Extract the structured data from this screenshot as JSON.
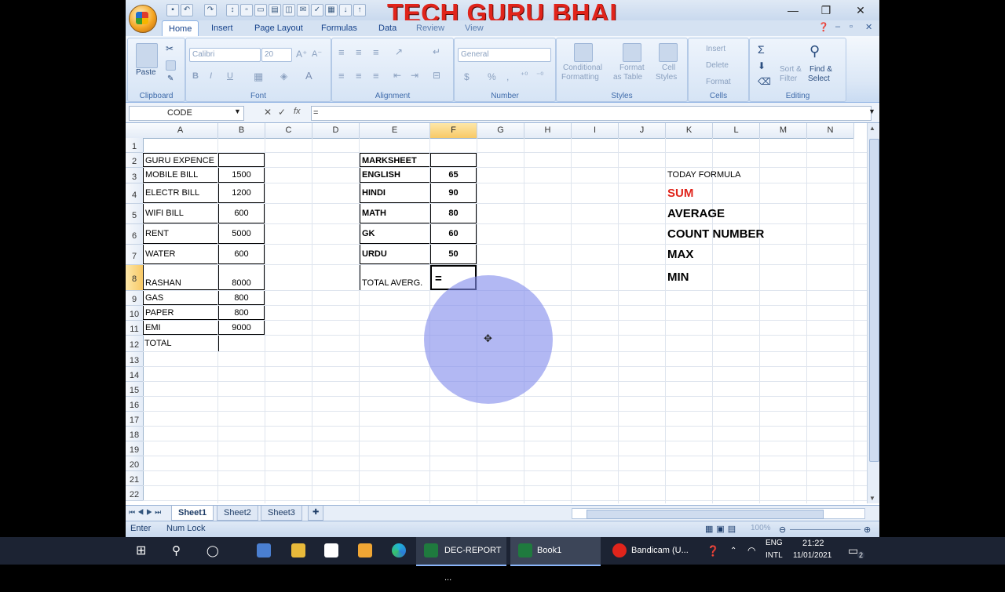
{
  "watermark": "TECH GURU BHAI",
  "ribbon": {
    "tabs": [
      "Home",
      "Insert",
      "Page Layout",
      "Formulas",
      "Data",
      "Review",
      "View"
    ],
    "active_tab": "Home",
    "groups": {
      "clipboard": {
        "label": "Clipboard",
        "paste": "Paste"
      },
      "font": {
        "label": "Font",
        "font_name": "Calibri",
        "font_size": "20",
        "bold": "B",
        "italic": "I",
        "underline": "U"
      },
      "alignment": {
        "label": "Alignment"
      },
      "number": {
        "label": "Number",
        "format": "General",
        "currency": "$",
        "percent": "%",
        "comma": ","
      },
      "styles": {
        "label": "Styles",
        "conditional": "Conditional",
        "conditional2": "Formatting",
        "format_table": "Format",
        "format_table2": "as Table",
        "cell_styles": "Cell",
        "cell_styles2": "Styles"
      },
      "cells": {
        "label": "Cells",
        "insert": "Insert",
        "delete": "Delete",
        "format": "Format"
      },
      "editing": {
        "label": "Editing",
        "sigma": "Σ",
        "sort": "Sort &",
        "sort2": "Filter",
        "find": "Find &",
        "find2": "Select"
      }
    }
  },
  "formula_bar": {
    "name_box": "CODE",
    "fx": "fx",
    "content": "="
  },
  "columns": [
    "A",
    "B",
    "C",
    "D",
    "E",
    "F",
    "G",
    "H",
    "I",
    "J",
    "K",
    "L",
    "M",
    "N"
  ],
  "selected_column": "F",
  "rows": [
    "1",
    "2",
    "3",
    "4",
    "5",
    "6",
    "7",
    "8",
    "9",
    "10",
    "11",
    "12",
    "13",
    "14",
    "15",
    "16",
    "17",
    "18",
    "19",
    "20",
    "21",
    "22"
  ],
  "selected_row": "8",
  "expenses": {
    "title": "GURU EXPENCE",
    "items": [
      {
        "label": "MOBILE BILL",
        "value": "1500"
      },
      {
        "label": "ELECTR BILL",
        "value": "1200"
      },
      {
        "label": "WIFI BILL",
        "value": "600"
      },
      {
        "label": "RENT",
        "value": "5000"
      },
      {
        "label": "WATER",
        "value": "600"
      },
      {
        "label": "RASHAN",
        "value": "8000"
      },
      {
        "label": "GAS",
        "value": "800"
      },
      {
        "label": "PAPER",
        "value": "800"
      },
      {
        "label": "EMI",
        "value": "9000"
      }
    ],
    "total_label": "TOTAL"
  },
  "marksheet": {
    "title": "MARKSHEET",
    "items": [
      {
        "label": "ENGLISH",
        "value": "65"
      },
      {
        "label": "HINDI",
        "value": "90"
      },
      {
        "label": "MATH",
        "value": "80"
      },
      {
        "label": "GK",
        "value": "60"
      },
      {
        "label": "URDU",
        "value": "50"
      }
    ],
    "total_label": "TOTAL AVERG.",
    "active_cell_value": "="
  },
  "formulas": {
    "heading": "TODAY FORMULA",
    "items": [
      "SUM",
      "AVERAGE",
      "COUNT NUMBER",
      "MAX",
      "MIN"
    ],
    "highlight_color": "#e0241b"
  },
  "sheets": [
    "Sheet1",
    "Sheet2",
    "Sheet3"
  ],
  "active_sheet": "Sheet1",
  "status": {
    "mode": "Enter",
    "num_lock": "Num Lock",
    "zoom": "100%"
  },
  "taskbar": {
    "apps": [
      "DEC-REPORT ...",
      "Book1",
      "Bandicam (U..."
    ],
    "lang": "ENG",
    "lang2": "INTL",
    "time": "21:22",
    "date": "11/01/2021",
    "notification_count": "2"
  },
  "colors": {
    "accent": "#15428b",
    "cursor_highlight": "#9aa6f0",
    "selected_header": "#f8c966"
  }
}
